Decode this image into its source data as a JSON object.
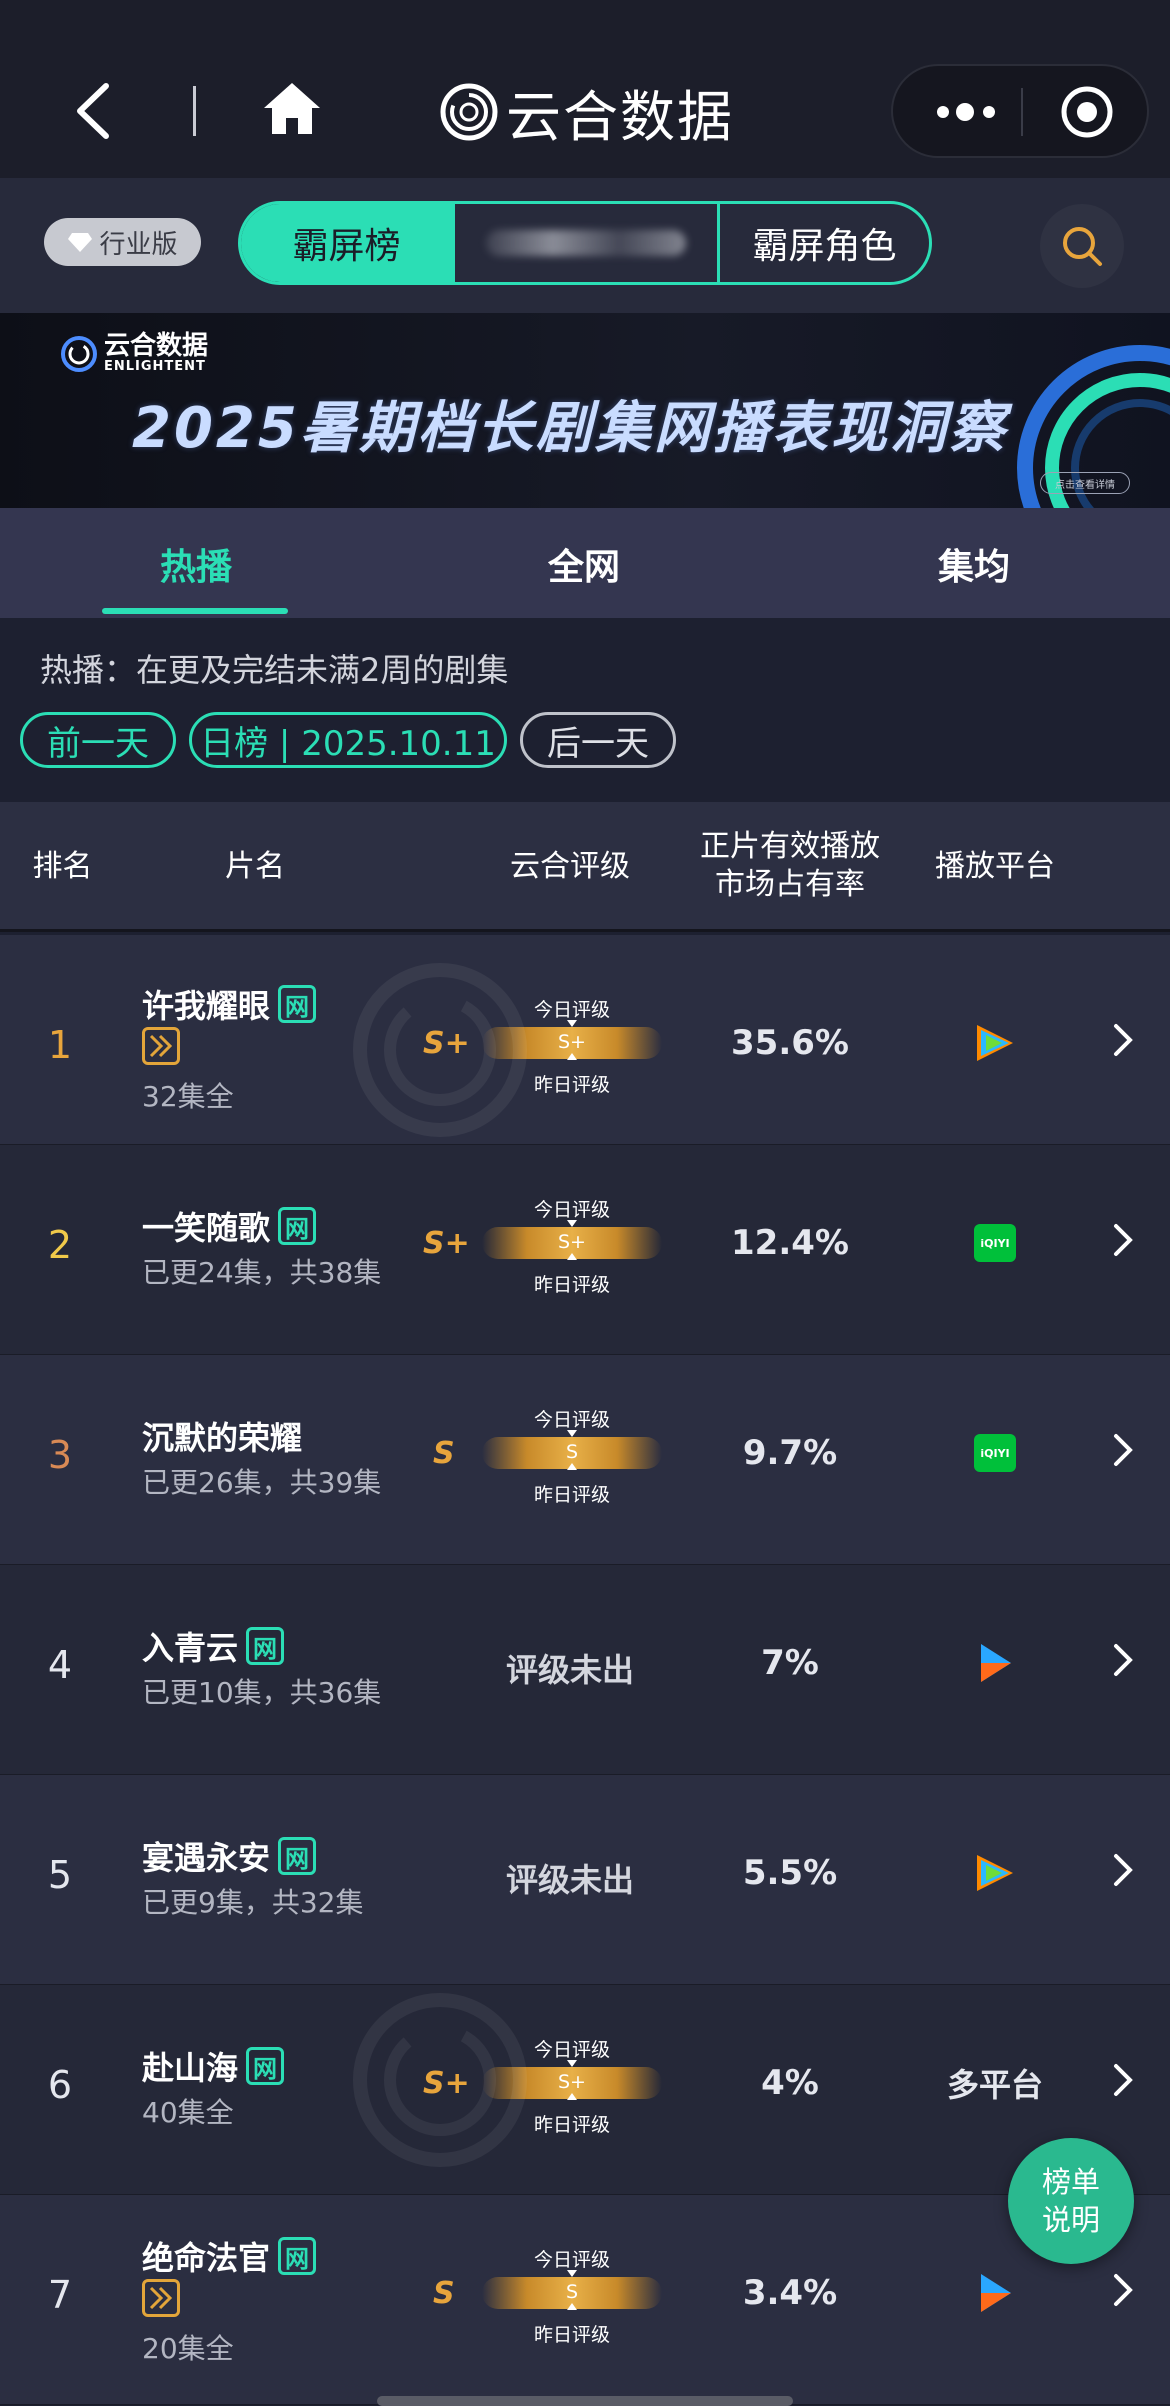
{
  "app": {
    "brand_name": "云合数据",
    "icons": [
      "back-icon",
      "home-icon",
      "more-dots-icon",
      "target-icon",
      "search-icon"
    ]
  },
  "filter_bar": {
    "industry_label": "行业版",
    "segments": [
      "霸屏榜",
      "",
      "霸屏角色"
    ],
    "active_segment": 0
  },
  "banner": {
    "logo_name": "云合数据",
    "logo_sub": "ENLIGHTENT",
    "title": "2025暑期档长剧集网播表现洞察",
    "cta": "点击查看详情"
  },
  "subtabs": {
    "items": [
      "热播",
      "全网",
      "集均"
    ],
    "active": 0
  },
  "description": "热播：在更及完结未满2周的剧集",
  "date_nav": {
    "prev": "前一天",
    "current": "日榜 | 2025.10.11",
    "next": "后一天"
  },
  "table": {
    "headers": {
      "rank": "排名",
      "title": "片名",
      "rating": "云合评级",
      "share_line1": "正片有效播放",
      "share_line2": "市场占有率",
      "platform": "播放平台"
    },
    "grade_labels": {
      "today": "今日评级",
      "yesterday": "昨日评级"
    },
    "rows": [
      {
        "rank": "1",
        "title": "许我耀眼",
        "net_badge": "网",
        "play_badge": true,
        "episodes": "32集全",
        "grade": "S+",
        "bar_grade": "S+",
        "share": "35.6%",
        "platform": "tencent-video-icon"
      },
      {
        "rank": "2",
        "title": "一笑随歌",
        "net_badge": "网",
        "play_badge": false,
        "episodes": "已更24集，共38集",
        "grade": "S+",
        "bar_grade": "S+",
        "share": "12.4%",
        "platform": "iqiyi-icon",
        "platform_label": "iQIYI"
      },
      {
        "rank": "3",
        "title": "沉默的荣耀",
        "net_badge": "",
        "play_badge": false,
        "episodes": "已更26集，共39集",
        "grade": "S",
        "bar_grade": "S",
        "share": "9.7%",
        "platform": "iqiyi-icon",
        "platform_label": "iQIYI"
      },
      {
        "rank": "4",
        "title": "入青云",
        "net_badge": "网",
        "play_badge": false,
        "episodes": "已更10集，共36集",
        "grade": "",
        "no_grade": "评级未出",
        "share": "7%",
        "platform": "youku-icon"
      },
      {
        "rank": "5",
        "title": "宴遇永安",
        "net_badge": "网",
        "play_badge": false,
        "episodes": "已更9集，共32集",
        "grade": "",
        "no_grade": "评级未出",
        "share": "5.5%",
        "platform": "tencent-video-icon"
      },
      {
        "rank": "6",
        "title": "赴山海",
        "net_badge": "网",
        "play_badge": false,
        "episodes": "40集全",
        "grade": "S+",
        "bar_grade": "S+",
        "share": "4%",
        "platform_text": "多平台"
      },
      {
        "rank": "7",
        "title": "绝命法官",
        "net_badge": "网",
        "play_badge": true,
        "episodes": "20集全",
        "grade": "S",
        "bar_grade": "S",
        "share": "3.4%",
        "platform": "youku-icon"
      }
    ]
  },
  "fab": {
    "line1": "榜单",
    "line2": "说明"
  },
  "colors": {
    "accent": "#2bdeb5",
    "gold": "#e8a53c",
    "rank1": "#e8a53c",
    "rank2": "#f0c94a",
    "rank3": "#d98a55"
  }
}
